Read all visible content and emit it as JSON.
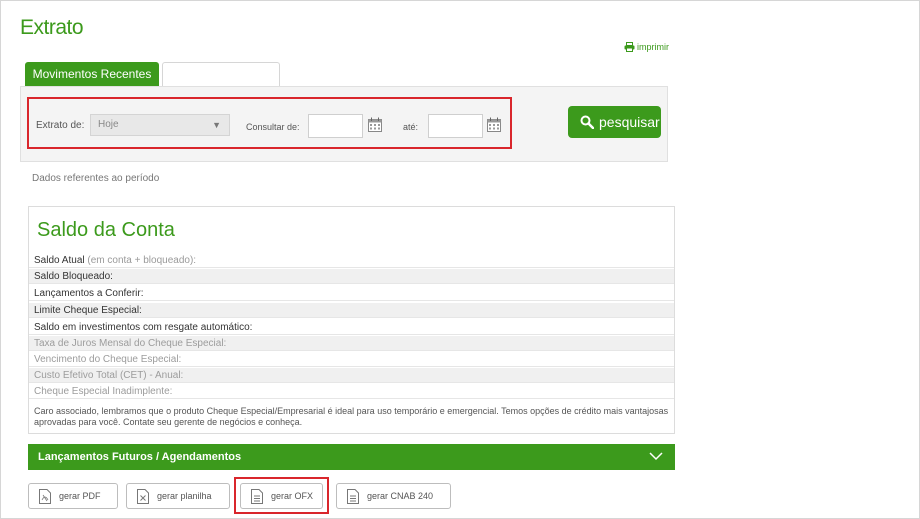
{
  "page": {
    "title": "Extrato",
    "print_label": "imprimir"
  },
  "tabs": [
    {
      "label": "Movimentos Recentes"
    },
    {
      "label": ""
    }
  ],
  "filter": {
    "extrato_label": "Extrato de:",
    "extrato_value": "Hoje",
    "consultar_label": "Consultar de:",
    "ate_label": "até:",
    "search_label": "pesquisar"
  },
  "period_text": "Dados referentes ao período",
  "saldo": {
    "title": "Saldo da Conta",
    "rows": [
      {
        "label": "Saldo Atual",
        "sub": "(em conta + bloqueado):"
      },
      {
        "label": "Saldo Bloqueado:"
      },
      {
        "label": "Lançamentos a Conferir:"
      },
      {
        "label": "Limite Cheque Especial:"
      },
      {
        "label": "Saldo em investimentos com resgate automático:"
      },
      {
        "label": "Taxa de Juros Mensal do Cheque Especial:"
      },
      {
        "label": "Vencimento do Cheque Especial:"
      },
      {
        "label": "Custo Efetivo Total (CET) - Anual:"
      },
      {
        "label": "Cheque Especial Inadimplente:"
      }
    ],
    "notice": "Caro associado, lembramos que o produto Cheque Especial/Empresarial é ideal para uso temporário e emergencial. Temos opções de crédito mais vantajosas aprovadas para você. Contate seu gerente de negócios e conheça."
  },
  "futuros": {
    "label": "Lançamentos Futuros / Agendamentos"
  },
  "buttons": [
    {
      "label": "gerar PDF",
      "icon": "pdf-file-icon"
    },
    {
      "label": "gerar planilha",
      "icon": "spreadsheet-file-icon"
    },
    {
      "label": "gerar OFX",
      "icon": "document-file-icon"
    },
    {
      "label": "gerar CNAB 240",
      "icon": "document-file-icon"
    }
  ],
  "colors": {
    "brand_green": "#3c9a1c",
    "highlight_red": "#d9262c"
  }
}
